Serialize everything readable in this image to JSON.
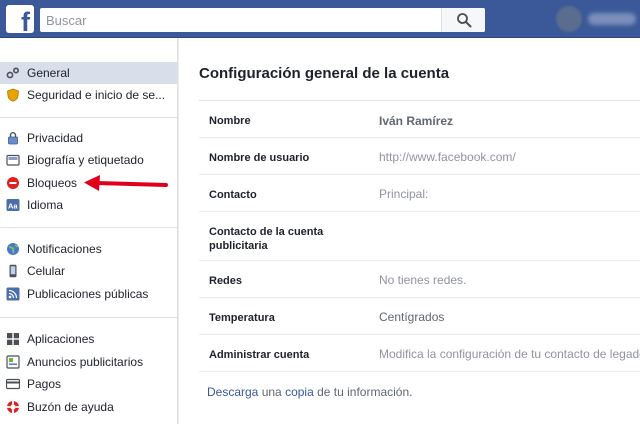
{
  "header": {
    "logo_letter": "f",
    "search_placeholder": "Buscar"
  },
  "sidebar": {
    "items": [
      {
        "label": "General",
        "icon": "gears-icon"
      },
      {
        "label": "Seguridad e inicio de se...",
        "icon": "shield-icon"
      },
      {
        "label": "Privacidad",
        "icon": "lock-icon"
      },
      {
        "label": "Biografía y etiquetado",
        "icon": "timeline-icon"
      },
      {
        "label": "Bloqueos",
        "icon": "block-icon"
      },
      {
        "label": "Idioma",
        "icon": "language-icon"
      },
      {
        "label": "Notificaciones",
        "icon": "globe-icon"
      },
      {
        "label": "Celular",
        "icon": "phone-icon"
      },
      {
        "label": "Publicaciones públicas",
        "icon": "rss-icon"
      },
      {
        "label": "Aplicaciones",
        "icon": "apps-icon"
      },
      {
        "label": "Anuncios publicitarios",
        "icon": "ads-icon"
      },
      {
        "label": "Pagos",
        "icon": "card-icon"
      },
      {
        "label": "Buzón de ayuda",
        "icon": "lifebuoy-icon"
      }
    ]
  },
  "main": {
    "title": "Configuración general de la cuenta",
    "rows": [
      {
        "key": "Nombre",
        "value": "Iván Ramírez"
      },
      {
        "key": "Nombre de usuario",
        "value": "http://www.facebook.com/"
      },
      {
        "key": "Contacto",
        "value": "Principal:"
      },
      {
        "key": "Contacto de la cuenta publicitaria",
        "value": ""
      },
      {
        "key": "Redes",
        "value": "No tienes redes."
      },
      {
        "key": "Temperatura",
        "value": "Centígrados"
      },
      {
        "key": "Administrar cuenta",
        "value": "Modifica la configuración de tu contacto de legado"
      }
    ],
    "footer": {
      "link1": "Descarga",
      "text1": " una ",
      "link2": "copia",
      "text2": " de tu información."
    }
  },
  "colors": {
    "brand": "#3b5998",
    "active_bg": "#d8dfea",
    "link": "#365899",
    "arrow": "#e0001b"
  }
}
